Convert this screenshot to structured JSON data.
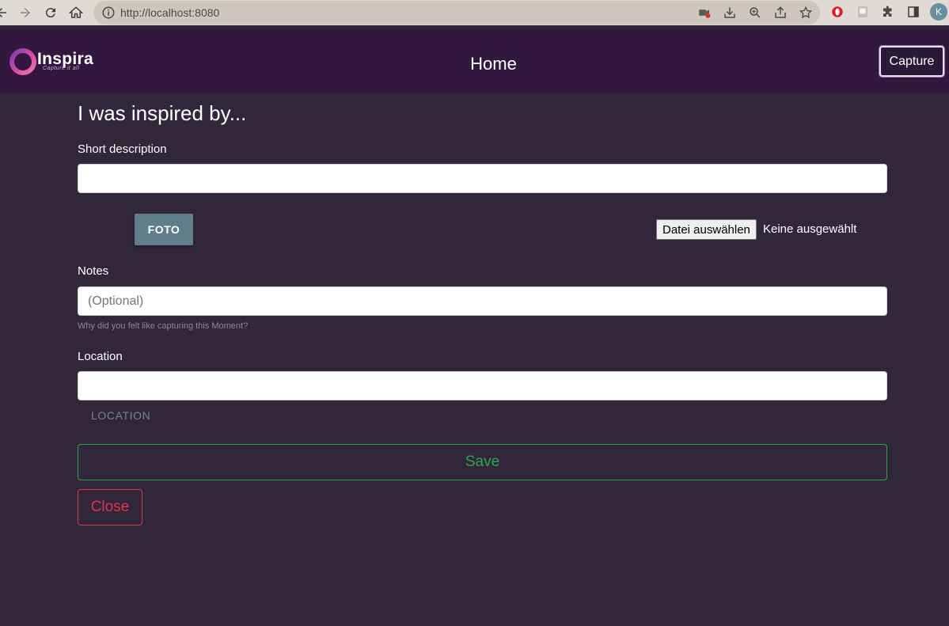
{
  "browser": {
    "url": "http://localhost:8080",
    "avatar_initial": "K"
  },
  "header": {
    "logo_name": "Inspira",
    "logo_tagline": "Capture it all",
    "title": "Home",
    "capture_label": "Capture"
  },
  "form": {
    "title": "I was inspired by...",
    "short_description_label": "Short description",
    "short_description_value": "",
    "foto_label": "FOTO",
    "file_button_label": "Datei auswählen",
    "file_status": "Keine ausgewählt",
    "notes_label": "Notes",
    "notes_placeholder": "(Optional)",
    "notes_hint": "Why did you felt like capturing this Moment?",
    "location_label": "Location",
    "location_value": "",
    "location_button_label": "LOCATION",
    "save_label": "Save",
    "close_label": "Close"
  },
  "colors": {
    "page_bg": "#32263b",
    "header_bg": "#32183f",
    "save": "#28a745",
    "close": "#dc3545",
    "foto_btn": "#607d8b"
  }
}
